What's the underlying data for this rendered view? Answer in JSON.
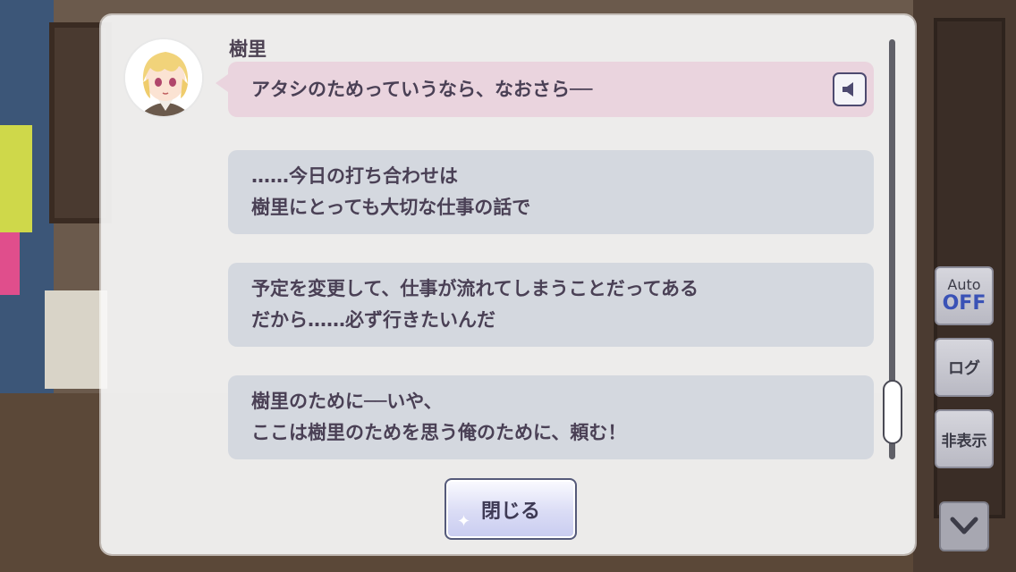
{
  "dialog": {
    "speaker": "樹里",
    "lines": [
      {
        "text": [
          "アタシのためっていうなら、なおさら──"
        ],
        "highlight": true
      },
      {
        "text": [
          "……今日の打ち合わせは",
          "樹里にとっても大切な仕事の話で"
        ]
      },
      {
        "text": [
          "予定を変更して、仕事が流れてしまうことだってある",
          "だから……必ず行きたいんだ"
        ]
      },
      {
        "text": [
          "樹里のために──いや、",
          "ここは樹里のためを思う俺のために、頼む！"
        ]
      }
    ],
    "close_label": "閉じる"
  },
  "controls": {
    "auto_label": "Auto",
    "auto_state": "OFF",
    "log_label": "ログ",
    "hide_label": "非表示"
  },
  "icons": {
    "voice": "speaker-icon",
    "down": "chevron-down-icon",
    "avatar": "character-avatar"
  },
  "colors": {
    "highlight_bubble": "#ead4de",
    "bubble": "#d4d8df",
    "text": "#4a4055",
    "auto_off": "#3a52b6"
  }
}
